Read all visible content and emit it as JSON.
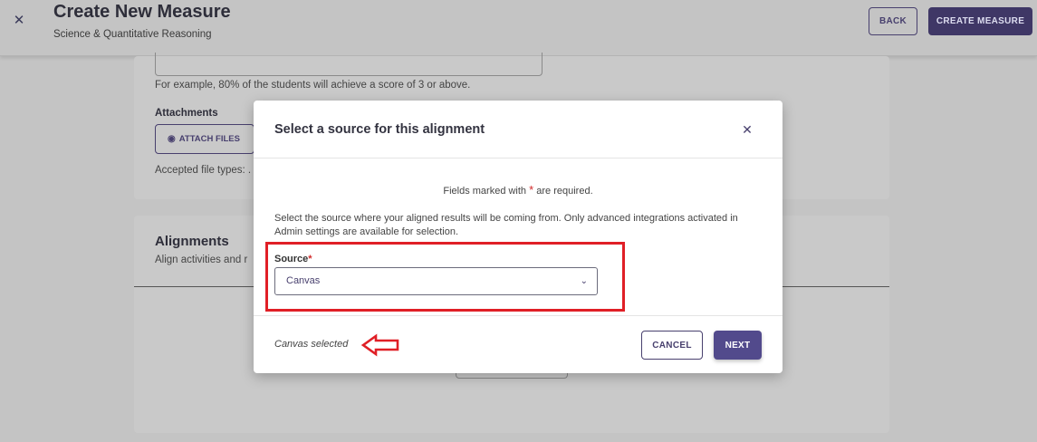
{
  "header": {
    "title": "Create New Measure",
    "subtitle": "Science & Quantitative Reasoning",
    "close_icon": "close-icon",
    "back_label": "BACK",
    "create_label": "CREATE MEASURE"
  },
  "background": {
    "hint_text": "For example, 80% of the students will achieve a score of 3 or above.",
    "attachments_label": "Attachments",
    "attach_button_label": "ATTACH FILES",
    "attach_icon": "eye-icon",
    "accepted_types_text": "Accepted file types: .",
    "alignments_title": "Alignments",
    "alignments_desc": "Align activities and r"
  },
  "modal": {
    "title": "Select a source for this alignment",
    "close_icon": "close-icon",
    "required_prefix": "Fields marked with",
    "required_star": "*",
    "required_suffix": "are required.",
    "instructions": "Select the source where your aligned results will be coming from. Only advanced integrations activated in Admin settings are available for selection.",
    "source_label": "Source",
    "source_star": "*",
    "source_value": "Canvas",
    "status_text": "Canvas selected",
    "cancel_label": "CANCEL",
    "next_label": "NEXT"
  },
  "colors": {
    "accent": "#48406e",
    "primary_button": "#524a8c",
    "annotation_red": "#e01f26",
    "required_red": "#d12b2b"
  }
}
